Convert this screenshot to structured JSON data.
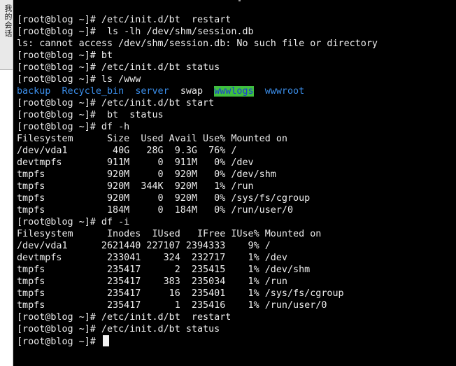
{
  "sidebar": {
    "tab_label": "我的会话"
  },
  "terminal": {
    "lines_before_ls": [
      "[root@blog ~]# /etc/init.d/bt  restart",
      "[root@blog ~]#  ls -lh /dev/shm/session.db",
      "ls: cannot access /dev/shm/session.db: No such file or directory",
      "[root@blog ~]# bt",
      "[root@blog ~]# /etc/init.d/bt status",
      "[root@blog ~]# ls /www"
    ],
    "ls_output": {
      "entries": [
        "backup",
        "Recycle_bin",
        "server",
        "swap",
        "wwwlogs",
        "wwwroot"
      ],
      "spacer": "  "
    },
    "lines_after_ls": [
      "[root@blog ~]# /etc/init.d/bt start",
      "[root@blog ~]#  bt  status",
      "[root@blog ~]# df -h",
      "Filesystem      Size  Used Avail Use% Mounted on",
      "/dev/vda1        40G   28G  9.3G  76% /",
      "devtmpfs        911M     0  911M   0% /dev",
      "tmpfs           920M     0  920M   0% /dev/shm",
      "tmpfs           920M  344K  920M   1% /run",
      "tmpfs           920M     0  920M   0% /sys/fs/cgroup",
      "tmpfs           184M     0  184M   0% /run/user/0",
      "[root@blog ~]# df -i",
      "Filesystem      Inodes  IUsed   IFree IUse% Mounted on",
      "/dev/vda1      2621440 227107 2394333    9% /",
      "devtmpfs        233041    324  232717    1% /dev",
      "tmpfs           235417      2  235415    1% /dev/shm",
      "tmpfs           235417    383  235034    1% /run",
      "tmpfs           235417     16  235401    1% /sys/fs/cgroup",
      "tmpfs           235417      1  235416    1% /run/user/0",
      "[root@blog ~]# /etc/init.d/bt  restart",
      "[root@blog ~]# /etc/init.d/bt status"
    ],
    "prompt": "[root@blog ~]# "
  },
  "colors": {
    "background": "#000000",
    "text": "#ececec",
    "directory": "#3b8eea",
    "highlight_bg": "#3fbf3f",
    "highlight_fg": "#1c3ad8"
  }
}
